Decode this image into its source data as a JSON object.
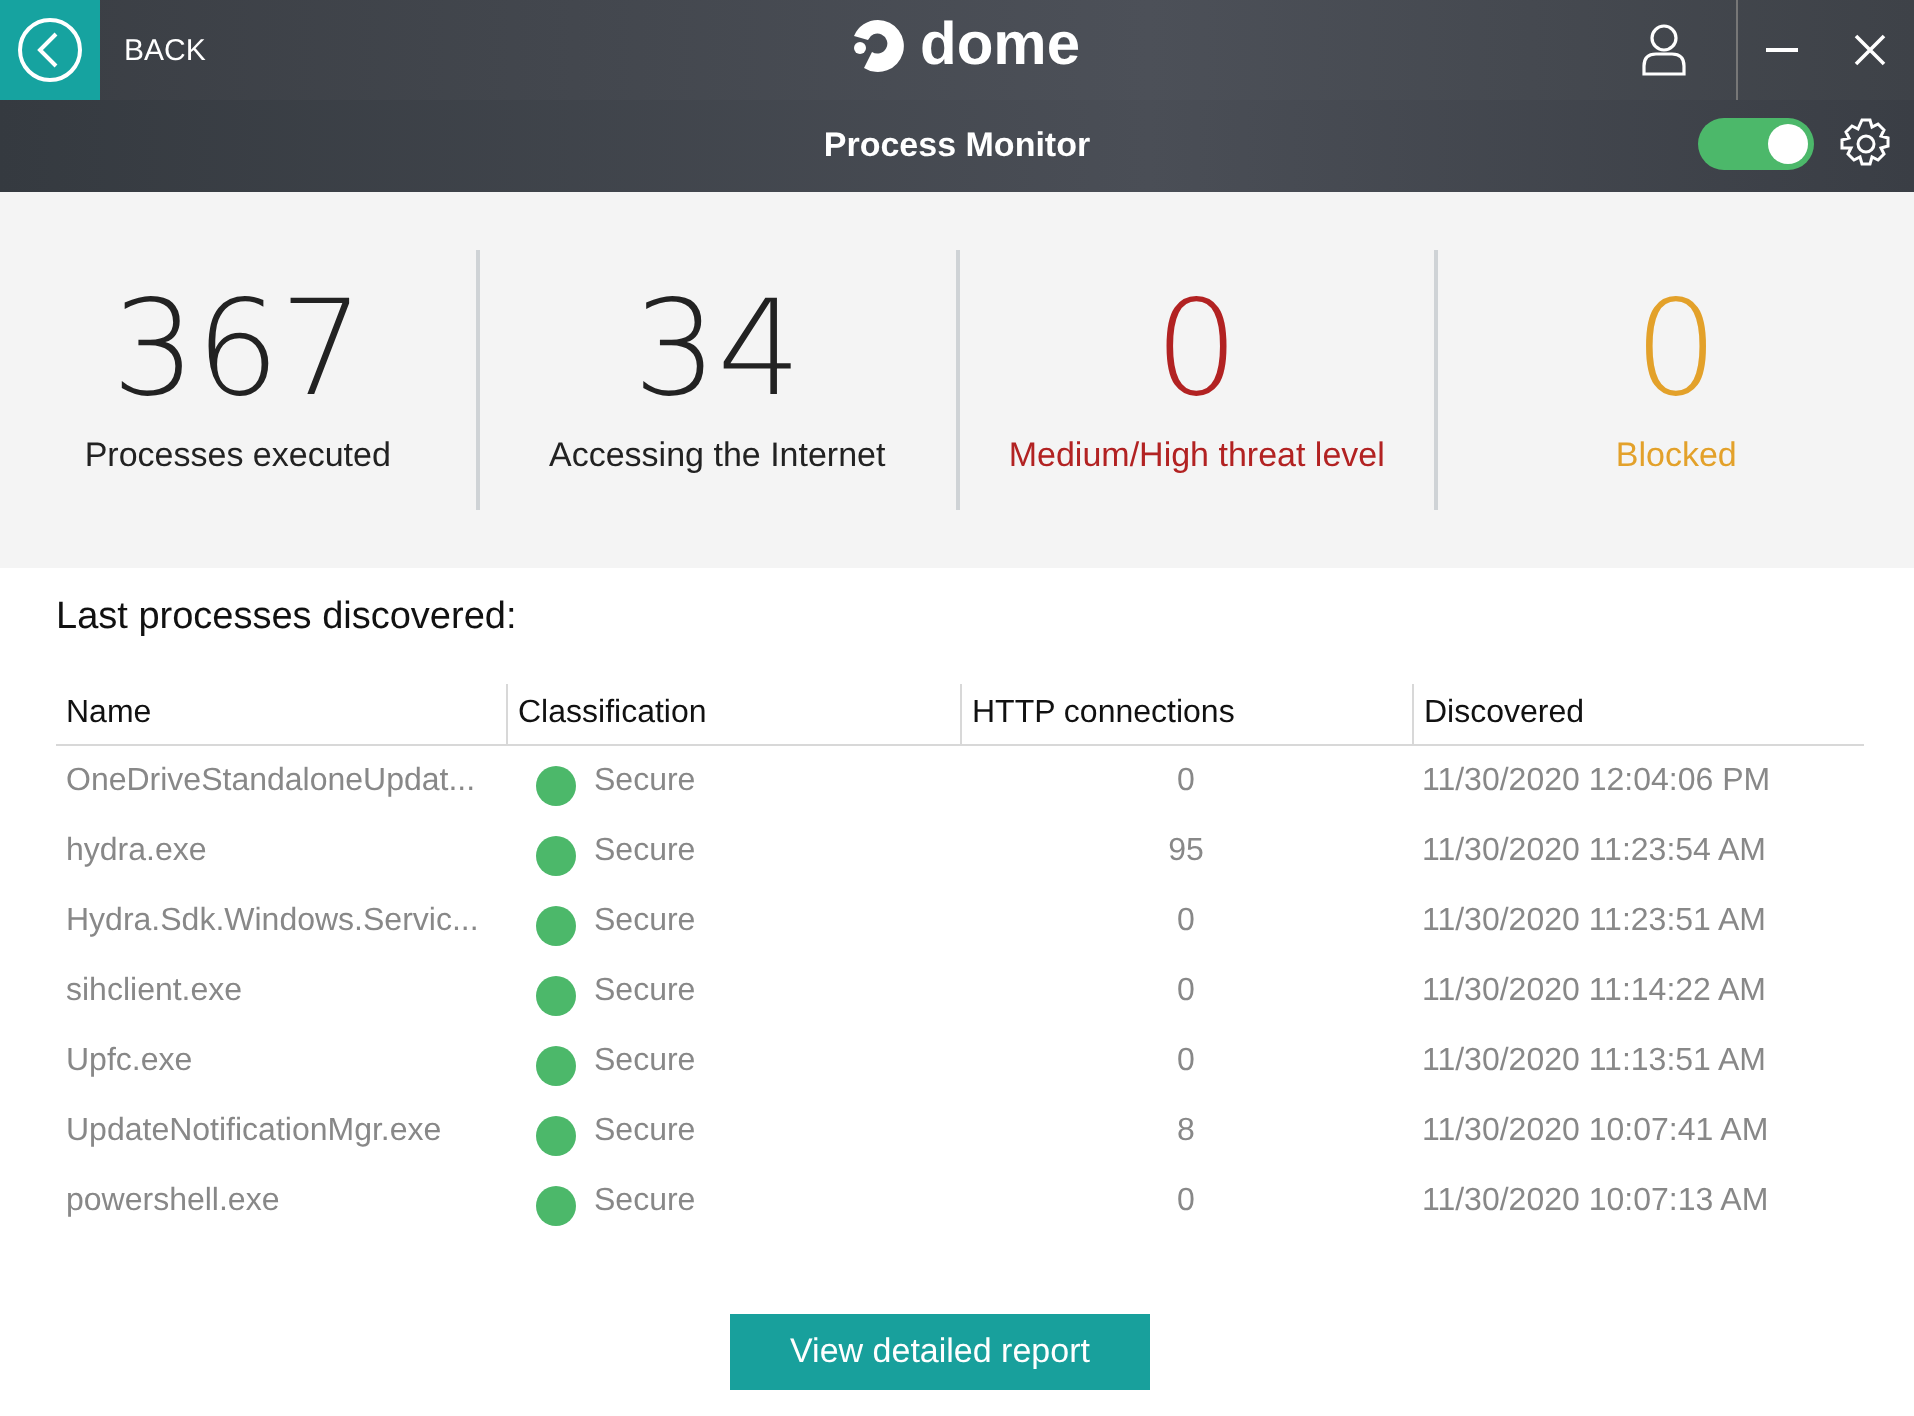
{
  "header": {
    "back_label": "BACK",
    "logo_text": "dome"
  },
  "toolbar": {
    "title": "Process Monitor",
    "monitor_on": true
  },
  "stats": [
    {
      "value": "367",
      "label": "Processes executed",
      "color": "#222222"
    },
    {
      "value": "34",
      "label": "Accessing the Internet",
      "color": "#222222"
    },
    {
      "value": "0",
      "label": "Medium/High threat level",
      "color": "#b22222"
    },
    {
      "value": "0",
      "label": "Blocked",
      "color": "#e3a12a"
    }
  ],
  "table": {
    "title": "Last processes discovered:",
    "columns": [
      "Name",
      "Classification",
      "HTTP connections",
      "Discovered"
    ],
    "rows": [
      {
        "name": "OneDriveStandaloneUpdat...",
        "classification": "Secure",
        "color": "#4cb86a",
        "http": "0",
        "discovered": "11/30/2020 12:04:06 PM"
      },
      {
        "name": "hydra.exe",
        "classification": "Secure",
        "color": "#4cb86a",
        "http": "95",
        "discovered": "11/30/2020 11:23:54 AM"
      },
      {
        "name": "Hydra.Sdk.Windows.Servic...",
        "classification": "Secure",
        "color": "#4cb86a",
        "http": "0",
        "discovered": "11/30/2020 11:23:51 AM"
      },
      {
        "name": "sihclient.exe",
        "classification": "Secure",
        "color": "#4cb86a",
        "http": "0",
        "discovered": "11/30/2020 11:14:22 AM"
      },
      {
        "name": "Upfc.exe",
        "classification": "Secure",
        "color": "#4cb86a",
        "http": "0",
        "discovered": "11/30/2020 11:13:51 AM"
      },
      {
        "name": "UpdateNotificationMgr.exe",
        "classification": "Secure",
        "color": "#4cb86a",
        "http": "8",
        "discovered": "11/30/2020 10:07:41 AM"
      },
      {
        "name": "powershell.exe",
        "classification": "Secure",
        "color": "#4cb86a",
        "http": "0",
        "discovered": "11/30/2020 10:07:13 AM"
      }
    ]
  },
  "report_button": "View detailed report"
}
